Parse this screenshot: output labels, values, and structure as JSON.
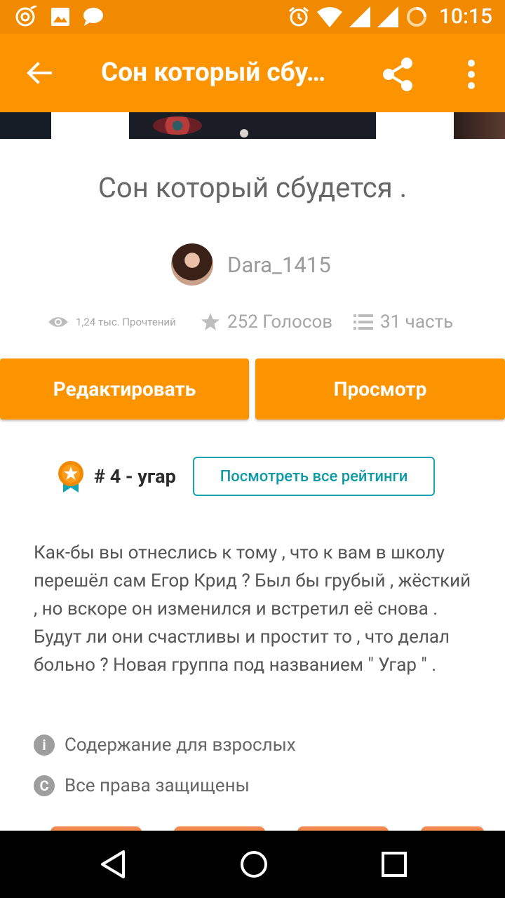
{
  "status_bar": {
    "time": "10:15",
    "left_icons": [
      "cast-icon",
      "image-icon",
      "chat-icon"
    ],
    "right_icons": [
      "alarm-icon",
      "wifi-icon",
      "signal-icon",
      "battery-icon"
    ]
  },
  "app_bar": {
    "title": "Сон который сбу…",
    "back_icon": "arrow-left-icon",
    "share_icon": "share-icon",
    "more_icon": "more-vert-icon"
  },
  "story": {
    "title": "Сон который сбудется .",
    "author": "Dara_1415",
    "reads": "1,24 тыс. Прочтений",
    "votes": "252 Голосов",
    "parts": "31 часть",
    "edit_label": "Редактировать",
    "view_label": "Просмотр",
    "rank": "# 4 - угар",
    "rank_button": "Посмотреть все рейтинги",
    "description": "Как-бы вы отнеслись к тому , что к вам в школу перешёл сам Егор Крид ? Был бы грубый , жёсткий , но вскоре он изменился и встретил её снова . Будут ли они счастливы и простит то  , что делал больно ? Новая группа под названием \" Угар \" .",
    "mature_label": "Содержание для взрослых",
    "rights_label": "Все права защищены"
  },
  "colors": {
    "accent": "#fb9400",
    "status_bar": "#f28a00",
    "teal": "#16a3ae",
    "text_grey": "#666666"
  }
}
